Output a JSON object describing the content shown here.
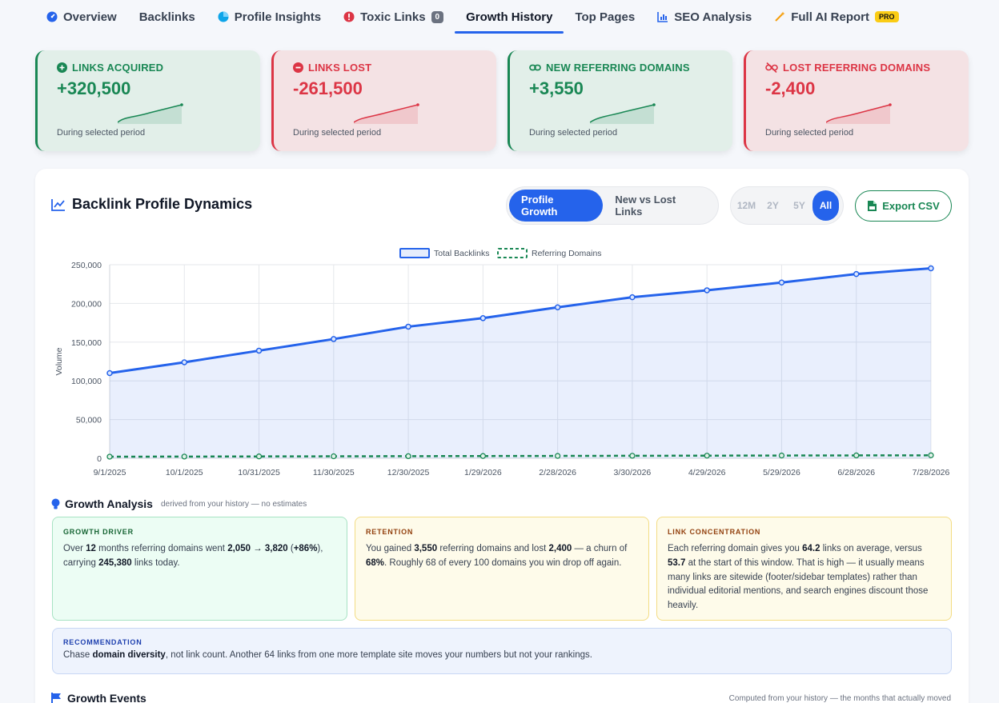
{
  "tabs": [
    {
      "label": "Overview",
      "icon": "dashboard-icon"
    },
    {
      "label": "Backlinks",
      "icon": ""
    },
    {
      "label": "Profile Insights",
      "icon": "pie-chart-icon"
    },
    {
      "label": "Toxic Links",
      "icon": "alert-icon",
      "badge": "0"
    },
    {
      "label": "Growth History",
      "icon": "",
      "active": true
    },
    {
      "label": "Top Pages",
      "icon": ""
    },
    {
      "label": "SEO Analysis",
      "icon": "bar-chart-icon"
    },
    {
      "label": "Full AI Report",
      "icon": "magic-wand-icon",
      "badge": "PRO"
    }
  ],
  "stats": [
    {
      "title": "LINKS ACQUIRED",
      "value": "+320,500",
      "sub": "During selected period",
      "tone": "green",
      "icon": "plus-circle-icon"
    },
    {
      "title": "LINKS LOST",
      "value": "-261,500",
      "sub": "During selected period",
      "tone": "red",
      "icon": "minus-circle-icon"
    },
    {
      "title": "NEW REFERRING DOMAINS",
      "value": "+3,550",
      "sub": "During selected period",
      "tone": "green",
      "icon": "link-icon"
    },
    {
      "title": "LOST REFERRING DOMAINS",
      "value": "-2,400",
      "sub": "During selected period",
      "tone": "red",
      "icon": "broken-link-icon"
    }
  ],
  "panel": {
    "title": "Backlink Profile Dynamics",
    "view_toggle": [
      "Profile Growth",
      "New vs Lost Links"
    ],
    "view_selected": "Profile Growth",
    "ranges": [
      "12M",
      "2Y",
      "5Y",
      "All"
    ],
    "range_selected": "All",
    "export_label": "Export CSV"
  },
  "colors": {
    "blue": "#2563eb",
    "green": "#198754",
    "red": "#dc3545"
  },
  "chart_data": {
    "type": "line",
    "x": [
      "9/1/2025",
      "10/1/2025",
      "10/31/2025",
      "11/30/2025",
      "12/30/2025",
      "1/29/2026",
      "2/28/2026",
      "3/30/2026",
      "4/29/2026",
      "5/29/2026",
      "6/28/2026",
      "7/28/2026"
    ],
    "series": [
      {
        "name": "Total Backlinks",
        "values": [
          110000,
          124000,
          139000,
          154000,
          170000,
          181000,
          195000,
          208000,
          217000,
          227000,
          238000,
          245380
        ],
        "color": "#2563eb",
        "fill": true
      },
      {
        "name": "Referring Domains",
        "values": [
          2050,
          2200,
          2380,
          2550,
          2720,
          2880,
          3050,
          3210,
          3380,
          3530,
          3690,
          3820
        ],
        "color": "#198754",
        "dashed": true
      }
    ],
    "ylabel": "Volume",
    "ylim": [
      0,
      250000
    ],
    "yticks": [
      "0",
      "50,000",
      "100,000",
      "150,000",
      "200,000",
      "250,000"
    ],
    "legend": "top",
    "grid": true
  },
  "analysis": {
    "title": "Growth Analysis",
    "subtitle": "derived from your history — no estimates",
    "driver_label": "GROWTH DRIVER",
    "retention_label": "RETENTION",
    "concentration_label": "LINK CONCENTRATION",
    "recommendation_label": "RECOMMENDATION"
  },
  "events": {
    "title": "Growth Events",
    "note": "Computed from your history — the months that actually moved"
  }
}
